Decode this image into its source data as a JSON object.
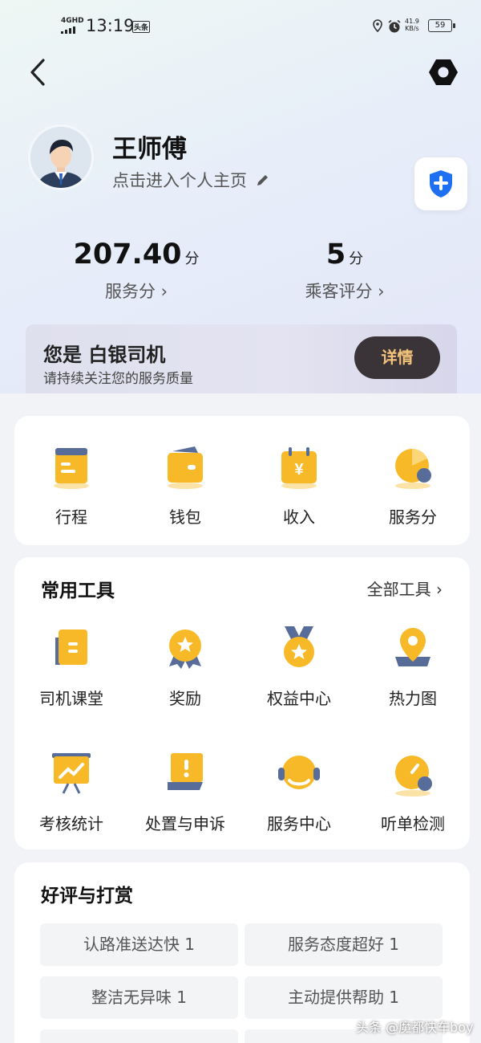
{
  "status_bar": {
    "network": "4GHD",
    "time": "13:19",
    "app_badge": "头条",
    "net_speed_value": "41.9",
    "net_speed_unit": "KB/s",
    "battery": "59"
  },
  "profile": {
    "name": "王师傅",
    "homepage_link": "点击进入个人主页"
  },
  "stats": [
    {
      "value": "207.40",
      "unit": "分",
      "label": "服务分 ›"
    },
    {
      "value": "5",
      "unit": "分",
      "label": "乘客评分 ›"
    }
  ],
  "level": {
    "title": "您是 白银司机",
    "subtitle": "请持续关注您的服务质量",
    "button": "详情"
  },
  "quick_actions": [
    {
      "label": "行程",
      "icon": "itinerary-icon"
    },
    {
      "label": "钱包",
      "icon": "wallet-icon"
    },
    {
      "label": "收入",
      "icon": "income-icon"
    },
    {
      "label": "服务分",
      "icon": "service-score-icon"
    }
  ],
  "tools": {
    "title": "常用工具",
    "all_link": "全部工具 ›",
    "items": [
      {
        "label": "司机课堂",
        "icon": "driver-class-icon"
      },
      {
        "label": "奖励",
        "icon": "reward-icon"
      },
      {
        "label": "权益中心",
        "icon": "benefits-icon"
      },
      {
        "label": "热力图",
        "icon": "heatmap-icon"
      },
      {
        "label": "考核统计",
        "icon": "assessment-stats-icon"
      },
      {
        "label": "处置与申诉",
        "icon": "appeal-icon"
      },
      {
        "label": "服务中心",
        "icon": "service-center-icon"
      },
      {
        "label": "听单检测",
        "icon": "order-check-icon"
      }
    ]
  },
  "reviews": {
    "title": "好评与打赏",
    "tags": [
      "认路准送达快 1",
      "服务态度超好 1",
      "整洁无异味 1",
      "主动提供帮助 1"
    ]
  },
  "watermark": "头条 @魔都快车boy",
  "colors": {
    "accent_yellow": "#f7b928",
    "shield_blue": "#1f6ff2",
    "detail_button_bg": "#3a3438",
    "detail_button_text": "#f3c37a"
  }
}
